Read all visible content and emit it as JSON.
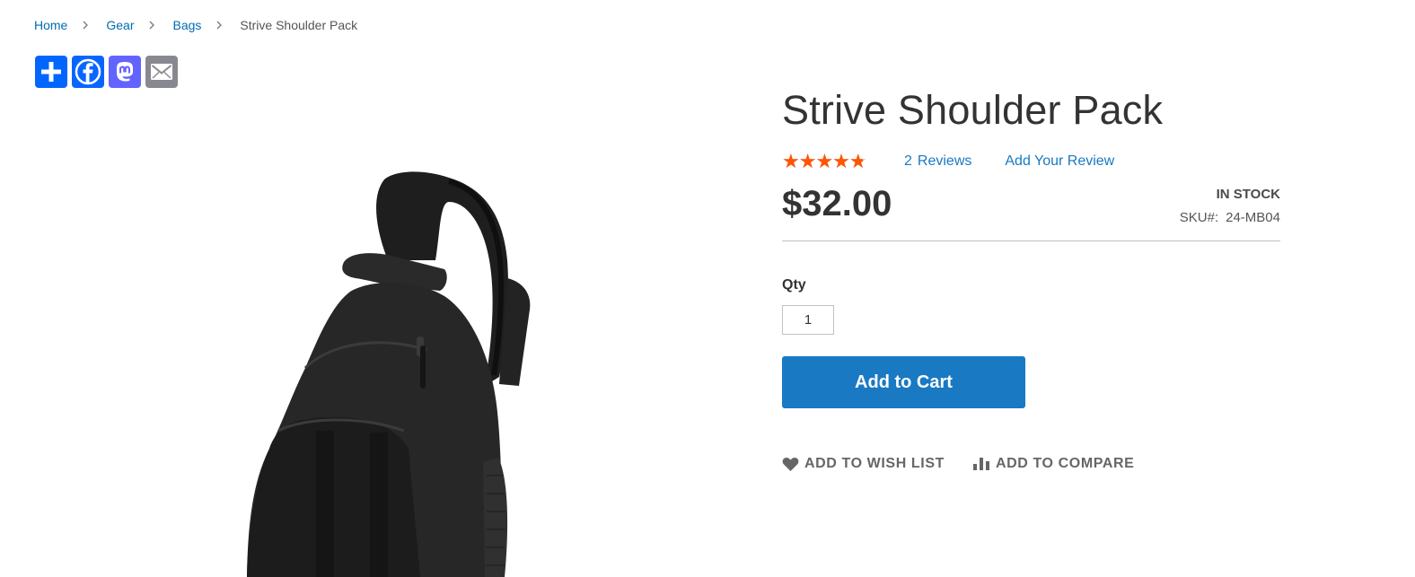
{
  "breadcrumb": {
    "items": [
      "Home",
      "Gear",
      "Bags"
    ],
    "current": "Strive Shoulder Pack"
  },
  "share": {
    "buttons": [
      {
        "icon": "share-plus-icon",
        "color": "#0166ff"
      },
      {
        "icon": "facebook-icon",
        "color": "#0866ff"
      },
      {
        "icon": "mastodon-icon",
        "color": "#6364ff"
      },
      {
        "icon": "email-icon",
        "color": "#888990"
      }
    ]
  },
  "product": {
    "title": "Strive Shoulder Pack",
    "rating_percent": 90,
    "review_count": "2",
    "reviews_label": "Reviews",
    "add_review_label": "Add Your Review",
    "price": "$32.00",
    "stock_status": "IN STOCK",
    "sku_label": "SKU#:",
    "sku_value": "24-MB04",
    "image_icon": "black-shoulder-backpack-image"
  },
  "cart": {
    "qty_label": "Qty",
    "qty_value": "1",
    "add_to_cart_label": "Add to Cart"
  },
  "actions": {
    "wishlist_label": "ADD TO WISH LIST",
    "wishlist_icon": "heart-icon",
    "compare_label": "ADD TO COMPARE",
    "compare_icon": "bar-chart-icon"
  },
  "colors": {
    "link": "#006bb4",
    "accent": "#1979c3",
    "star": "#ff5501",
    "text": "#333333"
  }
}
